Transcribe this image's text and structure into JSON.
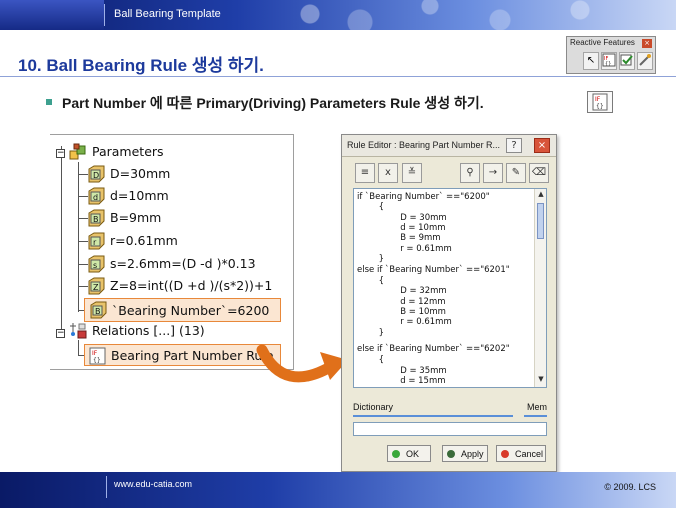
{
  "header": {
    "template_title": "Ball Bearing Template"
  },
  "page": {
    "title": "10. Ball Bearing Rule 생성 하기.",
    "bullet": "Part Number 에 따른 Primary(Driving) Parameters Rule 생성 하기."
  },
  "reactive_toolbar": {
    "title": "Reactive Features"
  },
  "tree": {
    "root": "Parameters",
    "parameters": [
      "D=30mm",
      "d=10mm",
      "B=9mm",
      "r=0.61mm",
      "s=2.6mm=(D -d )*0.13",
      "Z=8=int((D +d )/(s*2))+1",
      "`Bearing Number`=6200"
    ],
    "relations": "Relations [...] (13)",
    "rule": "Bearing Part Number Rule"
  },
  "rule_editor": {
    "title": "Rule Editor : Bearing Part Number R...",
    "code_lines": [
      "if `Bearing Number` ==\"6200\"",
      "        {",
      "                D = 30mm",
      "                d = 10mm",
      "                B = 9mm",
      "                r = 0.61mm",
      "        }",
      "else if `Bearing Number` ==\"6201\"",
      "        {",
      "                D = 32mm",
      "                d = 12mm",
      "                B = 10mm",
      "                r = 0.61mm",
      "        }",
      "else if `Bearing Number` ==\"6202\"",
      "        {",
      "                D = 35mm",
      "                d = 15mm"
    ],
    "dictionary_label": "Dictionary",
    "members_label": "Mem",
    "buttons": {
      "ok": "OK",
      "apply": "Apply",
      "cancel": "Cancel"
    }
  },
  "footer": {
    "url": "www.edu-catia.com",
    "copyright": "© 2009. LCS"
  },
  "colors": {
    "title_blue": "#1d3a9c",
    "highlight_orange": "#e8883a",
    "bullet_teal": "#3da08f"
  }
}
